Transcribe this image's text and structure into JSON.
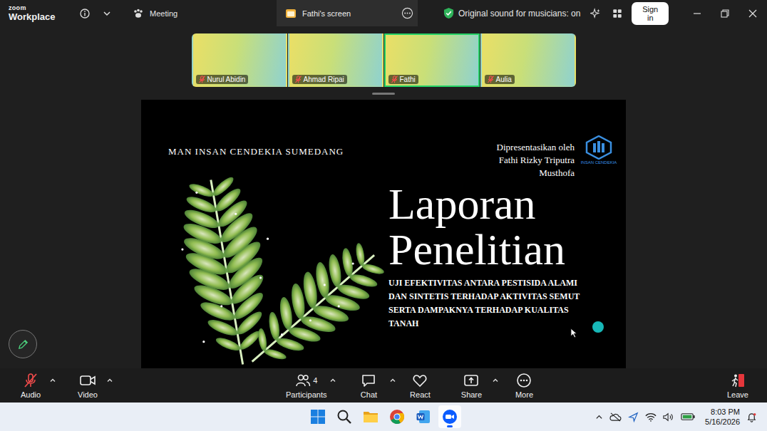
{
  "window": {
    "logo_top": "zoom",
    "logo_bottom": "Workplace",
    "meeting_label": "Meeting",
    "tab_title": "Fathi's screen",
    "audio_status": "Original sound for musicians: on",
    "sign_in": "Sign in"
  },
  "participants_strip": [
    {
      "name": "Nurul Abidin",
      "active_speaker": false,
      "muted": true
    },
    {
      "name": "Ahmad Ripai",
      "active_speaker": false,
      "muted": true
    },
    {
      "name": "Fathi",
      "active_speaker": true,
      "muted": true
    },
    {
      "name": "Aulia",
      "active_speaker": false,
      "muted": true
    }
  ],
  "shared_screen": {
    "school": "MAN INSAN CENDEKIA SUMEDANG",
    "presenter_lines": [
      "Dipresentasikan oleh",
      "Fathi Rizky Triputra",
      "Musthofa"
    ],
    "logo_caption": "INSAN CENDEKIA",
    "title_lines": [
      "Laporan",
      "Penelitian"
    ],
    "subtitle_lines": [
      "UJI EFEKTIVITAS ANTARA PESTISIDA ALAMI",
      "DAN SINTETIS TERHADAP AKTIVITAS SEMUT",
      "SERTA DAMPAKNYA TERHADAP KUALITAS",
      "TANAH"
    ]
  },
  "toolbar": {
    "audio": {
      "label": "Audio",
      "muted": true
    },
    "video": {
      "label": "Video"
    },
    "center": [
      {
        "kind": "participants",
        "label": "Participants",
        "count": "4",
        "has_menu": true
      },
      {
        "kind": "chat",
        "label": "Chat",
        "has_menu": true
      },
      {
        "kind": "react",
        "label": "React",
        "has_menu": false
      },
      {
        "kind": "share",
        "label": "Share",
        "has_menu": true
      },
      {
        "kind": "more",
        "label": "More",
        "has_menu": false
      }
    ],
    "leave": {
      "label": "Leave"
    }
  },
  "taskbar": {
    "apps": [
      {
        "kind": "start",
        "active": false
      },
      {
        "kind": "search",
        "active": false
      },
      {
        "kind": "explorer",
        "active": false
      },
      {
        "kind": "chrome",
        "active": false
      },
      {
        "kind": "word",
        "active": false
      },
      {
        "kind": "zoom",
        "active": true
      }
    ],
    "time": "8:03 PM",
    "date": "5/16/2026"
  }
}
